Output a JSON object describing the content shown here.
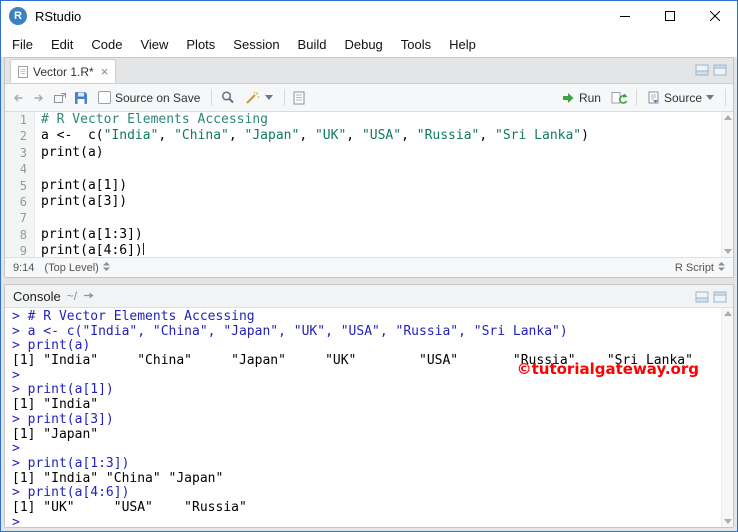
{
  "window": {
    "title": "RStudio"
  },
  "menu": {
    "items": [
      "File",
      "Edit",
      "Code",
      "View",
      "Plots",
      "Session",
      "Build",
      "Debug",
      "Tools",
      "Help"
    ]
  },
  "source_pane": {
    "tab": {
      "label": "Vector 1.R*",
      "close_glyph": "×"
    },
    "toolbar": {
      "source_on_save_label": "Source on Save",
      "run_label": "Run",
      "source_label": "Source"
    },
    "editor": {
      "lines": [
        {
          "tokens": [
            {
              "t": "comment",
              "s": "# R Vector Elements Accessing"
            }
          ]
        },
        {
          "tokens": [
            {
              "t": "plain",
              "s": "a <-  c("
            },
            {
              "t": "string",
              "s": "\"India\""
            },
            {
              "t": "plain",
              "s": ", "
            },
            {
              "t": "string",
              "s": "\"China\""
            },
            {
              "t": "plain",
              "s": ", "
            },
            {
              "t": "string",
              "s": "\"Japan\""
            },
            {
              "t": "plain",
              "s": ", "
            },
            {
              "t": "string",
              "s": "\"UK\""
            },
            {
              "t": "plain",
              "s": ", "
            },
            {
              "t": "string",
              "s": "\"USA\""
            },
            {
              "t": "plain",
              "s": ", "
            },
            {
              "t": "string",
              "s": "\"Russia\""
            },
            {
              "t": "plain",
              "s": ", "
            },
            {
              "t": "string",
              "s": "\"Sri Lanka\""
            },
            {
              "t": "plain",
              "s": ")"
            }
          ]
        },
        {
          "tokens": [
            {
              "t": "plain",
              "s": "print(a)"
            }
          ]
        },
        {
          "tokens": []
        },
        {
          "tokens": [
            {
              "t": "plain",
              "s": "print(a[1])"
            }
          ]
        },
        {
          "tokens": [
            {
              "t": "plain",
              "s": "print(a[3])"
            }
          ]
        },
        {
          "tokens": []
        },
        {
          "tokens": [
            {
              "t": "plain",
              "s": "print(a[1:3])"
            }
          ]
        },
        {
          "tokens": [
            {
              "t": "plain",
              "s": "print(a[4:6])"
            },
            {
              "t": "cursor",
              "s": ""
            }
          ]
        }
      ]
    },
    "status": {
      "cursor_position": "9:14",
      "scope": "(Top Level)",
      "file_type": "R Script"
    }
  },
  "console_pane": {
    "title": "Console",
    "path": "~/",
    "watermark": "©tutorialgateway.org",
    "lines": [
      {
        "t": "input",
        "s": "> # R Vector Elements Accessing"
      },
      {
        "t": "input",
        "s": "> a <- c(\"India\", \"China\", \"Japan\", \"UK\", \"USA\", \"Russia\", \"Sri Lanka\")"
      },
      {
        "t": "input",
        "s": "> print(a)"
      },
      {
        "t": "output",
        "s": "[1] \"India\"     \"China\"     \"Japan\"     \"UK\"        \"USA\"       \"Russia\"    \"Sri Lanka\""
      },
      {
        "t": "input",
        "s": "> "
      },
      {
        "t": "input",
        "s": "> print(a[1])"
      },
      {
        "t": "output",
        "s": "[1] \"India\""
      },
      {
        "t": "input",
        "s": "> print(a[3])"
      },
      {
        "t": "output",
        "s": "[1] \"Japan\""
      },
      {
        "t": "input",
        "s": "> "
      },
      {
        "t": "input",
        "s": "> print(a[1:3])"
      },
      {
        "t": "output",
        "s": "[1] \"India\" \"China\" \"Japan\""
      },
      {
        "t": "input",
        "s": "> print(a[4:6])"
      },
      {
        "t": "output",
        "s": "[1] \"UK\"     \"USA\"    \"Russia\""
      },
      {
        "t": "input",
        "s": "> "
      }
    ]
  },
  "colors": {
    "window_border": "#2f6fd4",
    "comment": "#2e8676",
    "string": "#0e7a60",
    "console_input": "#2222bb",
    "console_output": "#000000",
    "watermark_red": "#ff0000",
    "run_green": "#3fa044",
    "save_blue": "#4a7fc9"
  }
}
